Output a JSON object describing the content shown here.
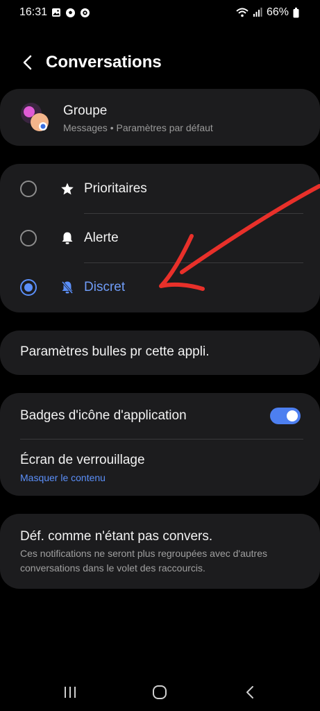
{
  "status": {
    "time": "16:31",
    "battery": "66%",
    "icons": [
      "gallery-icon",
      "soccer-ball-icon",
      "shield-icon",
      "wifi-icon",
      "signal-icon",
      "battery-icon"
    ]
  },
  "header": {
    "title": "Conversations"
  },
  "group": {
    "name": "Groupe",
    "subtitle": "Messages • Paramètres par défaut"
  },
  "priority": {
    "options": [
      {
        "label": "Prioritaires",
        "icon": "star-icon",
        "selected": false
      },
      {
        "label": "Alerte",
        "icon": "bell-icon",
        "selected": false
      },
      {
        "label": "Discret",
        "icon": "bell-off-icon",
        "selected": true
      }
    ]
  },
  "bubbles": {
    "label": "Paramètres bulles pr cette appli."
  },
  "settings": {
    "badges_label": "Badges d'icône d'application",
    "badges_on": true,
    "lock_label": "Écran de verrouillage",
    "lock_value": "Masquer le contenu"
  },
  "conversation": {
    "label": "Déf. comme n'étant pas convers.",
    "description": "Ces notifications ne seront plus regroupées avec d'autres conversations dans le volet des raccourcis."
  },
  "colors": {
    "background": "#000000",
    "card": "#1c1c1e",
    "accent": "#5b8ff9",
    "annotation": "#e8302a"
  },
  "navbar": {
    "icons": [
      "recents-icon",
      "home-icon",
      "back-icon"
    ]
  }
}
